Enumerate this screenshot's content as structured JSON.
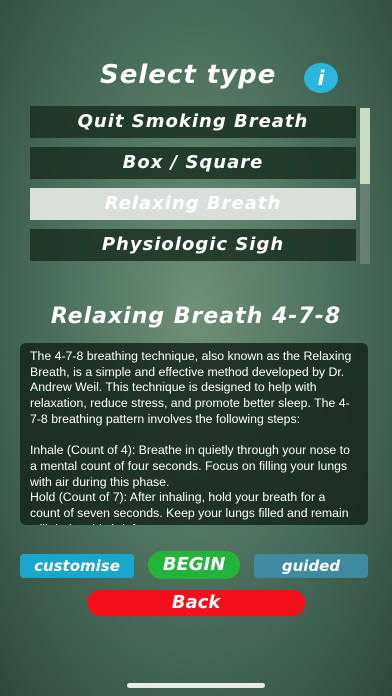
{
  "header": {
    "title": "Select type",
    "info_label": "i"
  },
  "types": {
    "selected": "Relaxing Breath",
    "items": [
      {
        "label": "Quit Smoking Breath"
      },
      {
        "label": "Box / Square"
      },
      {
        "label": "Relaxing Breath"
      },
      {
        "label": "Physiologic Sigh"
      }
    ]
  },
  "detail": {
    "title": "Relaxing Breath  4-7-8",
    "description": "The 4-7-8 breathing technique, also known as the Relaxing Breath, is a simple and effective method developed by Dr. Andrew Weil. This technique is designed to help with relaxation, reduce stress, and promote better sleep. The 4-7-8 breathing pattern involves the following steps:\n\nInhale (Count of 4): Breathe in quietly through your nose to a mental count of four seconds. Focus on filling your lungs with air during this phase.\nHold (Count of 7): After inhaling, hold your breath for a count of seven seconds. Keep your lungs filled and remain still during this brief pause."
  },
  "actions": {
    "customise": "customise",
    "begin": "BEGIN",
    "guided": "guided",
    "back": "Back"
  },
  "colors": {
    "info": "#2bb6dc",
    "customise": "#19a8cc",
    "begin": "#23b53a",
    "guided": "#3d8aa1",
    "back": "#f40f1a"
  }
}
